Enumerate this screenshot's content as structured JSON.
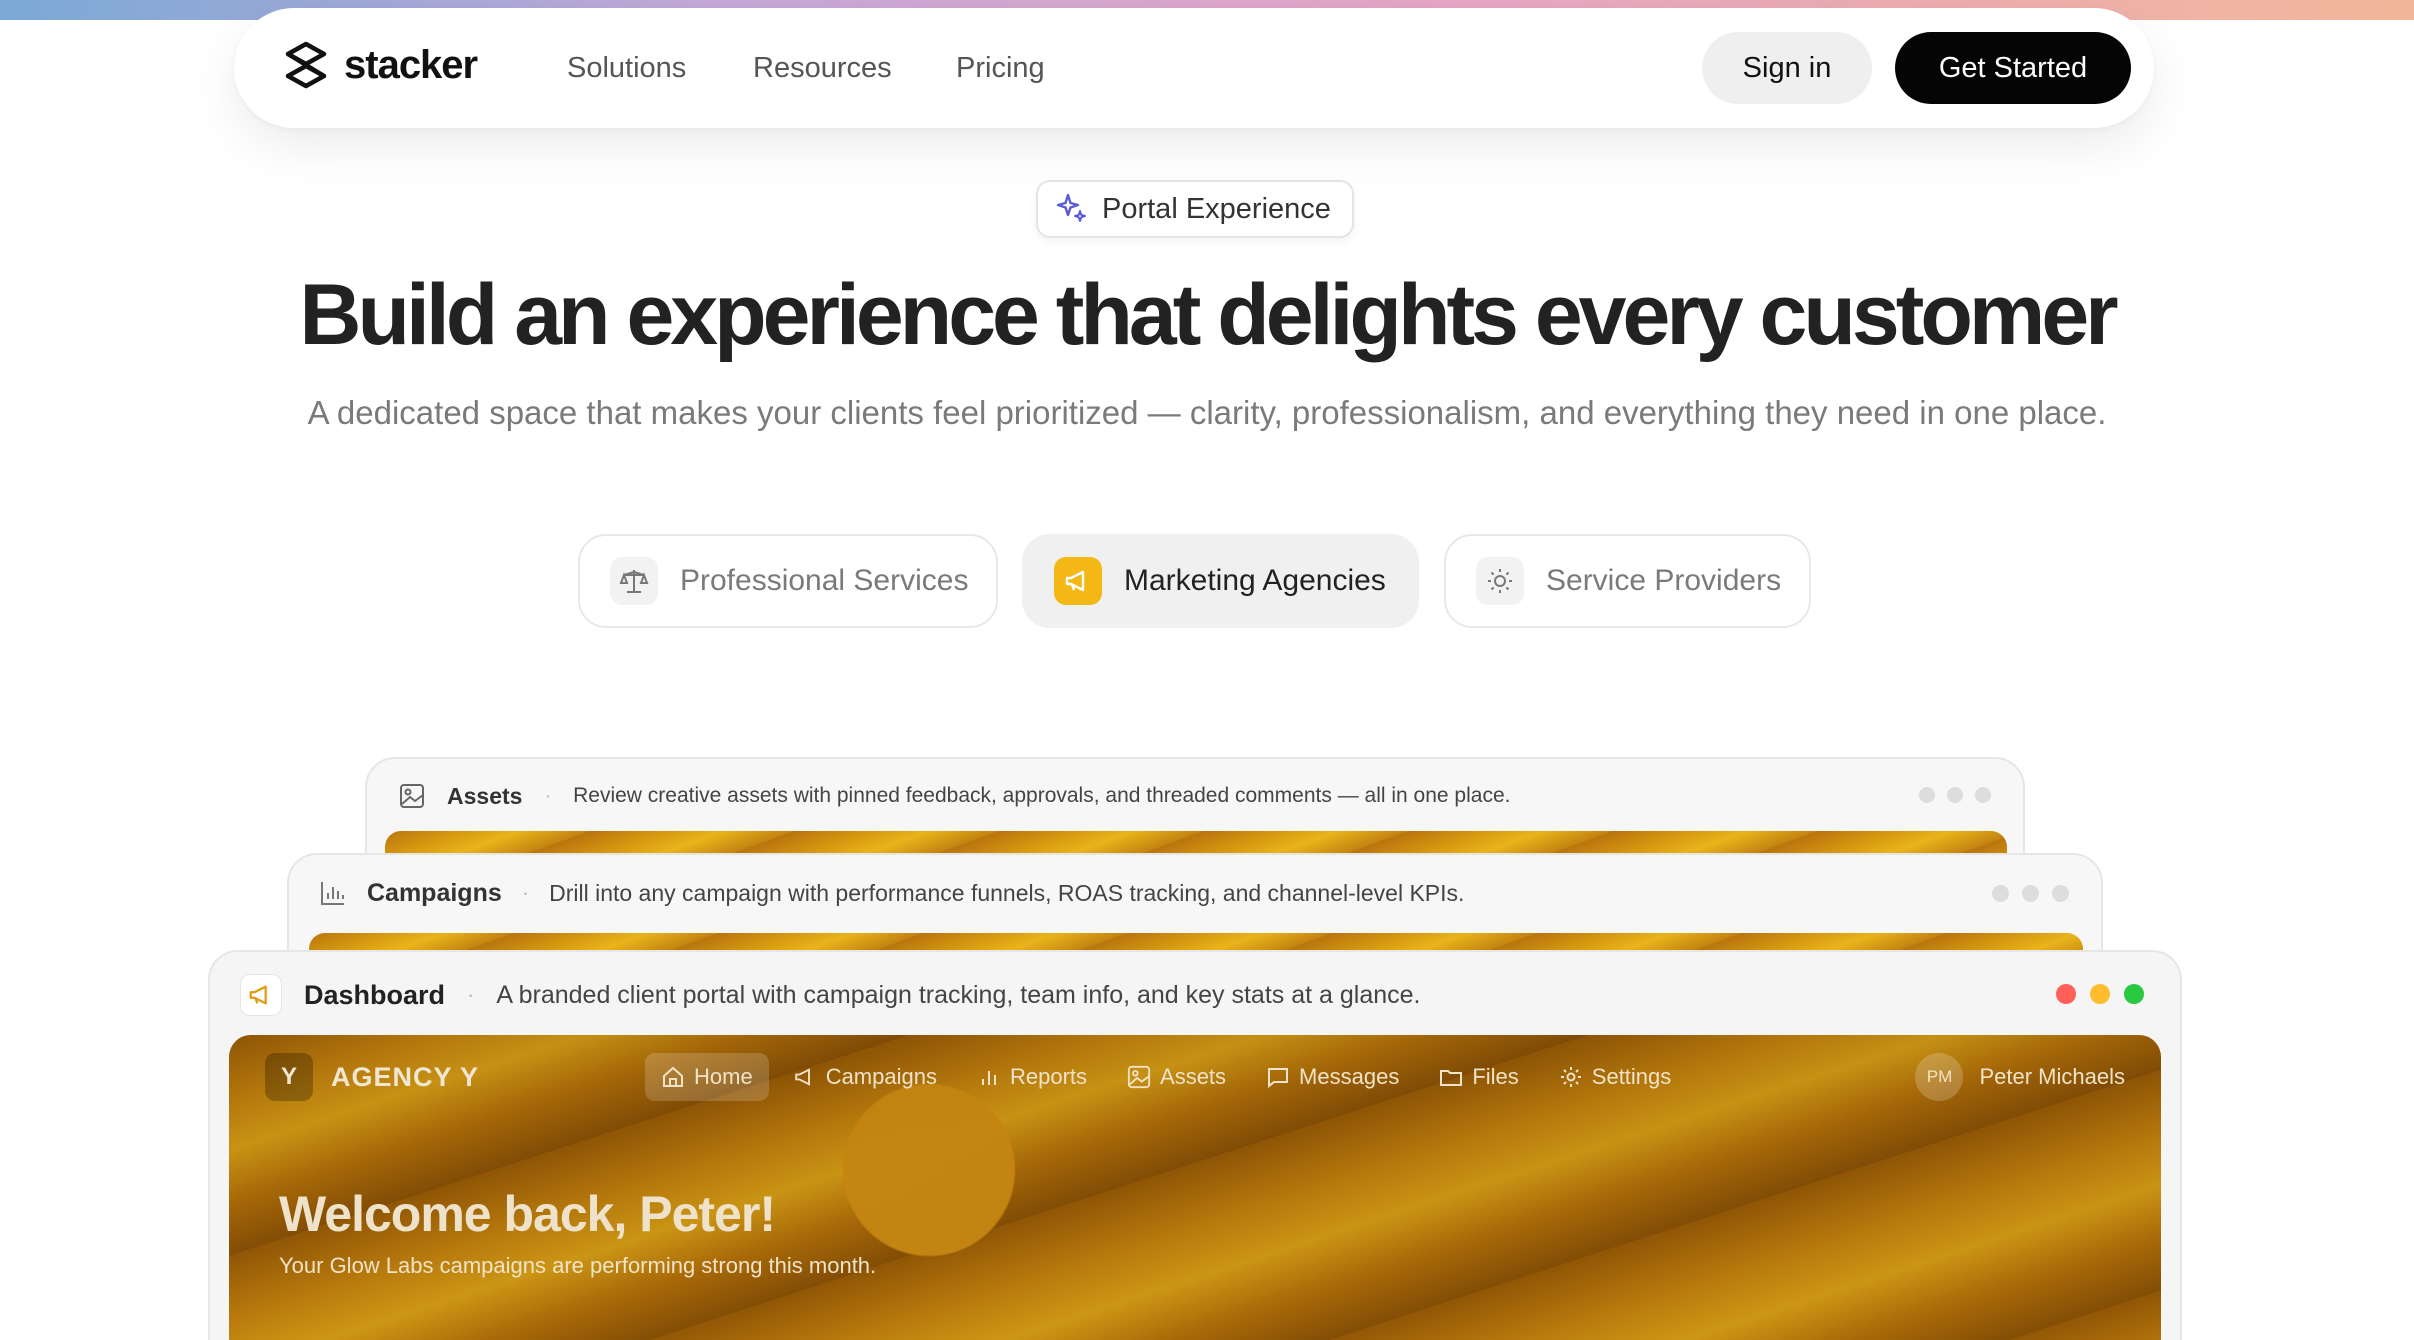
{
  "header": {
    "logo_text": "stacker",
    "nav": [
      "Solutions",
      "Resources",
      "Pricing"
    ],
    "sign_in": "Sign in",
    "get_started": "Get Started"
  },
  "hero": {
    "badge": "Portal Experience",
    "title": "Build an experience that delights every customer",
    "subtitle": "A dedicated space that makes your clients feel prioritized — clarity, professionalism, and everything they need in one place."
  },
  "segments": [
    {
      "label": "Professional Services",
      "icon": "scale-icon",
      "active": false
    },
    {
      "label": "Marketing Agencies",
      "icon": "megaphone-icon",
      "active": true
    },
    {
      "label": "Service Providers",
      "icon": "sun-icon",
      "active": false
    }
  ],
  "cards": {
    "assets": {
      "title": "Assets",
      "description": "Review creative assets with pinned feedback, approvals, and threaded comments — all in one place."
    },
    "campaigns": {
      "title": "Campaigns",
      "description": "Drill into any campaign with performance funnels, ROAS tracking, and channel-level KPIs."
    },
    "dashboard": {
      "title": "Dashboard",
      "description": "A branded client portal with campaign tracking, team info, and key stats at a glance."
    }
  },
  "app": {
    "logo_letter": "Y",
    "brand": "AGENCY Y",
    "nav": [
      "Home",
      "Campaigns",
      "Reports",
      "Assets",
      "Messages",
      "Files",
      "Settings"
    ],
    "user_initials": "PM",
    "user_name": "Peter Michaels",
    "welcome": "Welcome back, Peter!",
    "welcome_sub": "Your Glow Labs campaigns are performing strong this month."
  },
  "colors": {
    "accent_yellow": "#f3b816",
    "cta_black": "#050505",
    "window_red": "#ff5f57",
    "window_yellow": "#febc2e",
    "window_green": "#28c840"
  }
}
